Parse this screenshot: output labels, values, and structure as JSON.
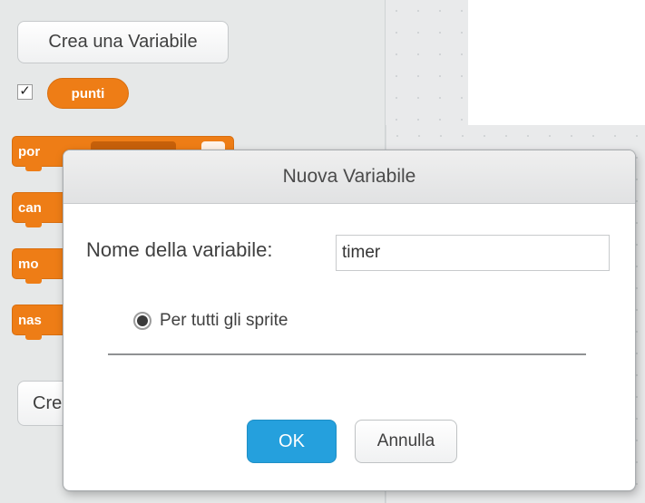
{
  "palette": {
    "make_variable_label": "Crea una Variabile",
    "make_variable_label_truncated": "Cre",
    "variable": {
      "name": "punti",
      "checked": true
    },
    "blocks": [
      {
        "label": "por"
      },
      {
        "label": "can"
      },
      {
        "label": "mo"
      },
      {
        "label": "nas"
      }
    ]
  },
  "dialog": {
    "title": "Nuova Variabile",
    "name_label": "Nome della variabile:",
    "name_value": "timer",
    "scope_option_label": "Per tutti gli sprite",
    "scope_selected": true,
    "ok_label": "OK",
    "cancel_label": "Annulla"
  },
  "colors": {
    "variable_block": "#ee7d16",
    "ok_button": "#25a0dd"
  }
}
